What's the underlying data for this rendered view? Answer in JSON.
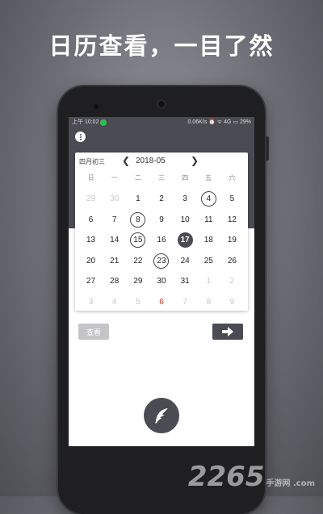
{
  "headline": "日历查看，一目了然",
  "status_bar": {
    "time": "上午 10:02",
    "right": "0.06K/s ⏰ ᯤ 4G ▭ 29%"
  },
  "calendar": {
    "lunar_date": "四月初三",
    "month": "2018-05",
    "weekdays": [
      "日",
      "一",
      "二",
      "三",
      "四",
      "五",
      "六"
    ],
    "days": [
      {
        "label": "29",
        "state": "muted"
      },
      {
        "label": "30",
        "state": "muted"
      },
      {
        "label": "1",
        "state": "normal"
      },
      {
        "label": "2",
        "state": "normal"
      },
      {
        "label": "3",
        "state": "normal"
      },
      {
        "label": "4",
        "state": "ring"
      },
      {
        "label": "5",
        "state": "normal"
      },
      {
        "label": "6",
        "state": "normal"
      },
      {
        "label": "7",
        "state": "normal"
      },
      {
        "label": "8",
        "state": "ring"
      },
      {
        "label": "9",
        "state": "normal"
      },
      {
        "label": "10",
        "state": "normal"
      },
      {
        "label": "11",
        "state": "normal"
      },
      {
        "label": "12",
        "state": "normal"
      },
      {
        "label": "13",
        "state": "normal"
      },
      {
        "label": "14",
        "state": "normal"
      },
      {
        "label": "15",
        "state": "ring"
      },
      {
        "label": "16",
        "state": "normal"
      },
      {
        "label": "17",
        "state": "selected"
      },
      {
        "label": "18",
        "state": "normal"
      },
      {
        "label": "19",
        "state": "normal"
      },
      {
        "label": "20",
        "state": "normal"
      },
      {
        "label": "21",
        "state": "normal"
      },
      {
        "label": "22",
        "state": "normal"
      },
      {
        "label": "23",
        "state": "ring"
      },
      {
        "label": "24",
        "state": "normal"
      },
      {
        "label": "25",
        "state": "normal"
      },
      {
        "label": "26",
        "state": "normal"
      },
      {
        "label": "27",
        "state": "normal"
      },
      {
        "label": "28",
        "state": "normal"
      },
      {
        "label": "29",
        "state": "normal"
      },
      {
        "label": "30",
        "state": "normal"
      },
      {
        "label": "31",
        "state": "normal"
      },
      {
        "label": "1",
        "state": "muted"
      },
      {
        "label": "2",
        "state": "muted"
      },
      {
        "label": "3",
        "state": "muted"
      },
      {
        "label": "4",
        "state": "muted"
      },
      {
        "label": "5",
        "state": "muted"
      },
      {
        "label": "6",
        "state": "red"
      },
      {
        "label": "7",
        "state": "muted"
      },
      {
        "label": "8",
        "state": "muted"
      },
      {
        "label": "9",
        "state": "muted"
      }
    ]
  },
  "buttons": {
    "view_label": "查看",
    "go_icon": "arrow-right-icon",
    "fab_icon": "feather-icon",
    "menu_icon": "more-vertical-icon"
  },
  "watermark": {
    "number": "2265",
    "site": "手游网 .com"
  },
  "colors": {
    "accent": "#4b4b53",
    "highlight_red": "#d22b2b",
    "status_green": "#2fbf4c"
  }
}
